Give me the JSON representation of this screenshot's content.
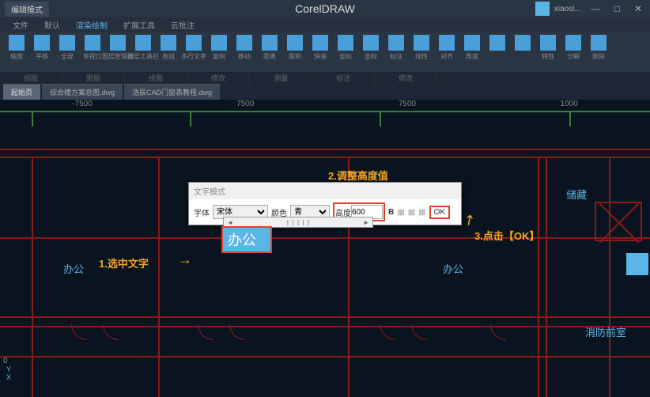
{
  "titlebar": {
    "mode": "编辑模式",
    "center_title": "CorelDRAW",
    "username": "xiaosi..."
  },
  "menubar": {
    "items": [
      "文件",
      "默认",
      "渲染绘制",
      "扩展工具",
      "云批注"
    ],
    "active_index": 2
  },
  "ribbon": [
    "缩放",
    "平移",
    "全屏",
    "单视口",
    "图层管理器",
    "图层工具栏",
    "直线",
    "多行文字",
    "复制",
    "移动",
    "距离",
    "面积",
    "快速",
    "坐标",
    "坐标",
    "标注",
    "线性",
    "对齐",
    "角度",
    "",
    "",
    "特性",
    "分解",
    "删除"
  ],
  "groups": [
    "视图",
    "图层",
    "绘图",
    "修改",
    "测量",
    "标注",
    "修改"
  ],
  "tabs": {
    "home": "起始页",
    "items": [
      "综合楼方案总图.dwg",
      "浩辰CAD门窗表教程.dwg"
    ]
  },
  "ruler_top": [
    "-7500",
    "7500",
    "7500",
    "1000"
  ],
  "room_labels": {
    "bangong1": "办公",
    "bangong2": "办公",
    "bangong3": "办公",
    "chucang": "储藏",
    "xiaofang": "消防前室"
  },
  "annotations": {
    "step1": "1.选中文字",
    "step2": "2.调整高度值",
    "step3": "3.点击【OK】"
  },
  "text_dialog": {
    "title": "文字模式",
    "font_label": "字体",
    "font_value": "宋体",
    "color_label": "颜色",
    "color_value": "青",
    "height_label": "高度",
    "height_value": "600",
    "bold": "B",
    "ok": "OK"
  },
  "edit_text": "办公",
  "axis": {
    "x": "X",
    "y": "Y"
  }
}
